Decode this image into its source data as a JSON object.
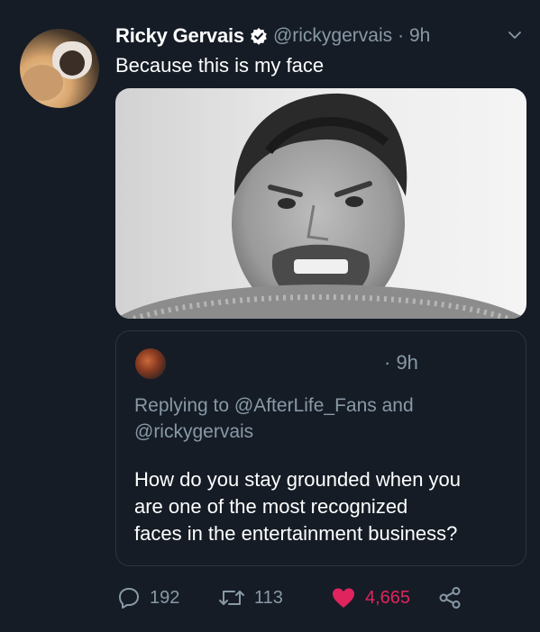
{
  "tweet": {
    "author_name": "Ricky Gervais",
    "handle": "@rickygervais",
    "time": "· 9h",
    "text": "Because this is my face"
  },
  "quoted": {
    "time": "· 9h",
    "reply_line1": "Replying to @AfterLife_Fans and",
    "reply_line2": "@rickygervais",
    "body_line1": "How do you stay grounded when you",
    "body_line2": "are one of the most recognized",
    "body_line3": "faces in the entertainment business?"
  },
  "actions": {
    "replies": "192",
    "retweets": "113",
    "likes": "4,665"
  },
  "colors": {
    "background": "#151c26",
    "secondary_text": "#8899a6",
    "like": "#e0245e"
  },
  "icons": [
    "verified-badge-icon",
    "chevron-down-icon",
    "reply-icon",
    "retweet-icon",
    "heart-icon",
    "share-icon"
  ]
}
